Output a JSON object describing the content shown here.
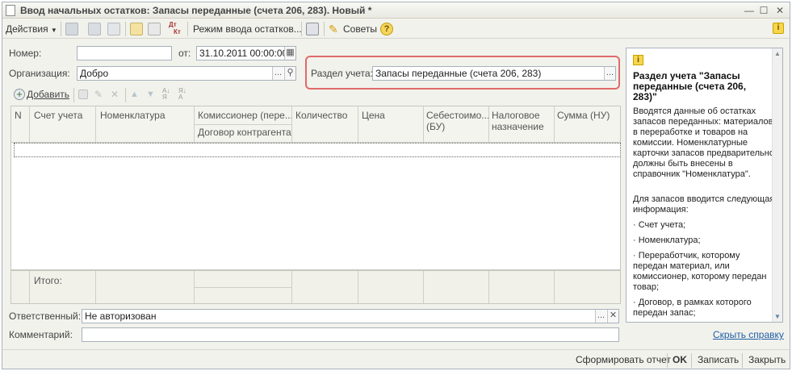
{
  "window": {
    "title": "Ввод начальных остатков: Запасы переданные (счета 206, 283). Новый *"
  },
  "toolbar": {
    "actions": "Действия",
    "mode": "Режим ввода остатков...",
    "tips": "Советы",
    "dtkt_top": "Дт",
    "dtkt_bottom": "Кт"
  },
  "form": {
    "number_label": "Номер:",
    "number_value": "",
    "date_label": "от:",
    "date_value": "31.10.2011 00:00:00",
    "org_label": "Организация:",
    "org_value": "Добро",
    "section_label": "Раздел учета:",
    "section_value": "Запасы переданные (счета 206, 283)",
    "responsible_label": "Ответственный:",
    "responsible_value": "Не авторизован",
    "comment_label": "Комментарий:",
    "comment_value": ""
  },
  "table_toolbar": {
    "add": "Добавить"
  },
  "table": {
    "col_n": "N",
    "col_account": "Счет учета",
    "col_nomenclature": "Номенклатура",
    "col_commissioner": "Комиссионер (пере...",
    "col_contract": "Договор контрагента",
    "col_quantity": "Количество",
    "col_price": "Цена",
    "col_cost_l1": "Себестоимо...",
    "col_cost_l2": "(БУ)",
    "col_tax_l1": "Налоговое",
    "col_tax_l2": "назначение",
    "col_sum": "Сумма (НУ)",
    "total_label": "Итого:"
  },
  "help": {
    "title": "Раздел учета \"Запасы переданные (счета 206, 283)\"",
    "p1": "Вводятся данные об остатках запасов переданных: материалов в переработке и товаров на комиссии. Номенклатурные карточки запасов предварительно должны быть внесены в справочник \"Номенклатура\".",
    "p2": "Для запасов вводится следующая информация:",
    "b1": "· Счет учета;",
    "b2": "· Номенклатура;",
    "b3": "· Переработчик, которому передан материал, или комиссионер, которому передан товар;",
    "b4": "· Договор, в рамках которого передан запас;",
    "hide_link": "Скрыть справку"
  },
  "bottom": {
    "report": "Сформировать отчет",
    "ok": "OK",
    "save": "Записать",
    "close": "Закрыть"
  },
  "colors": {
    "highlight_border": "#e06a6a",
    "link": "#1f5ea8",
    "accent_yellow": "#f7d64b"
  }
}
